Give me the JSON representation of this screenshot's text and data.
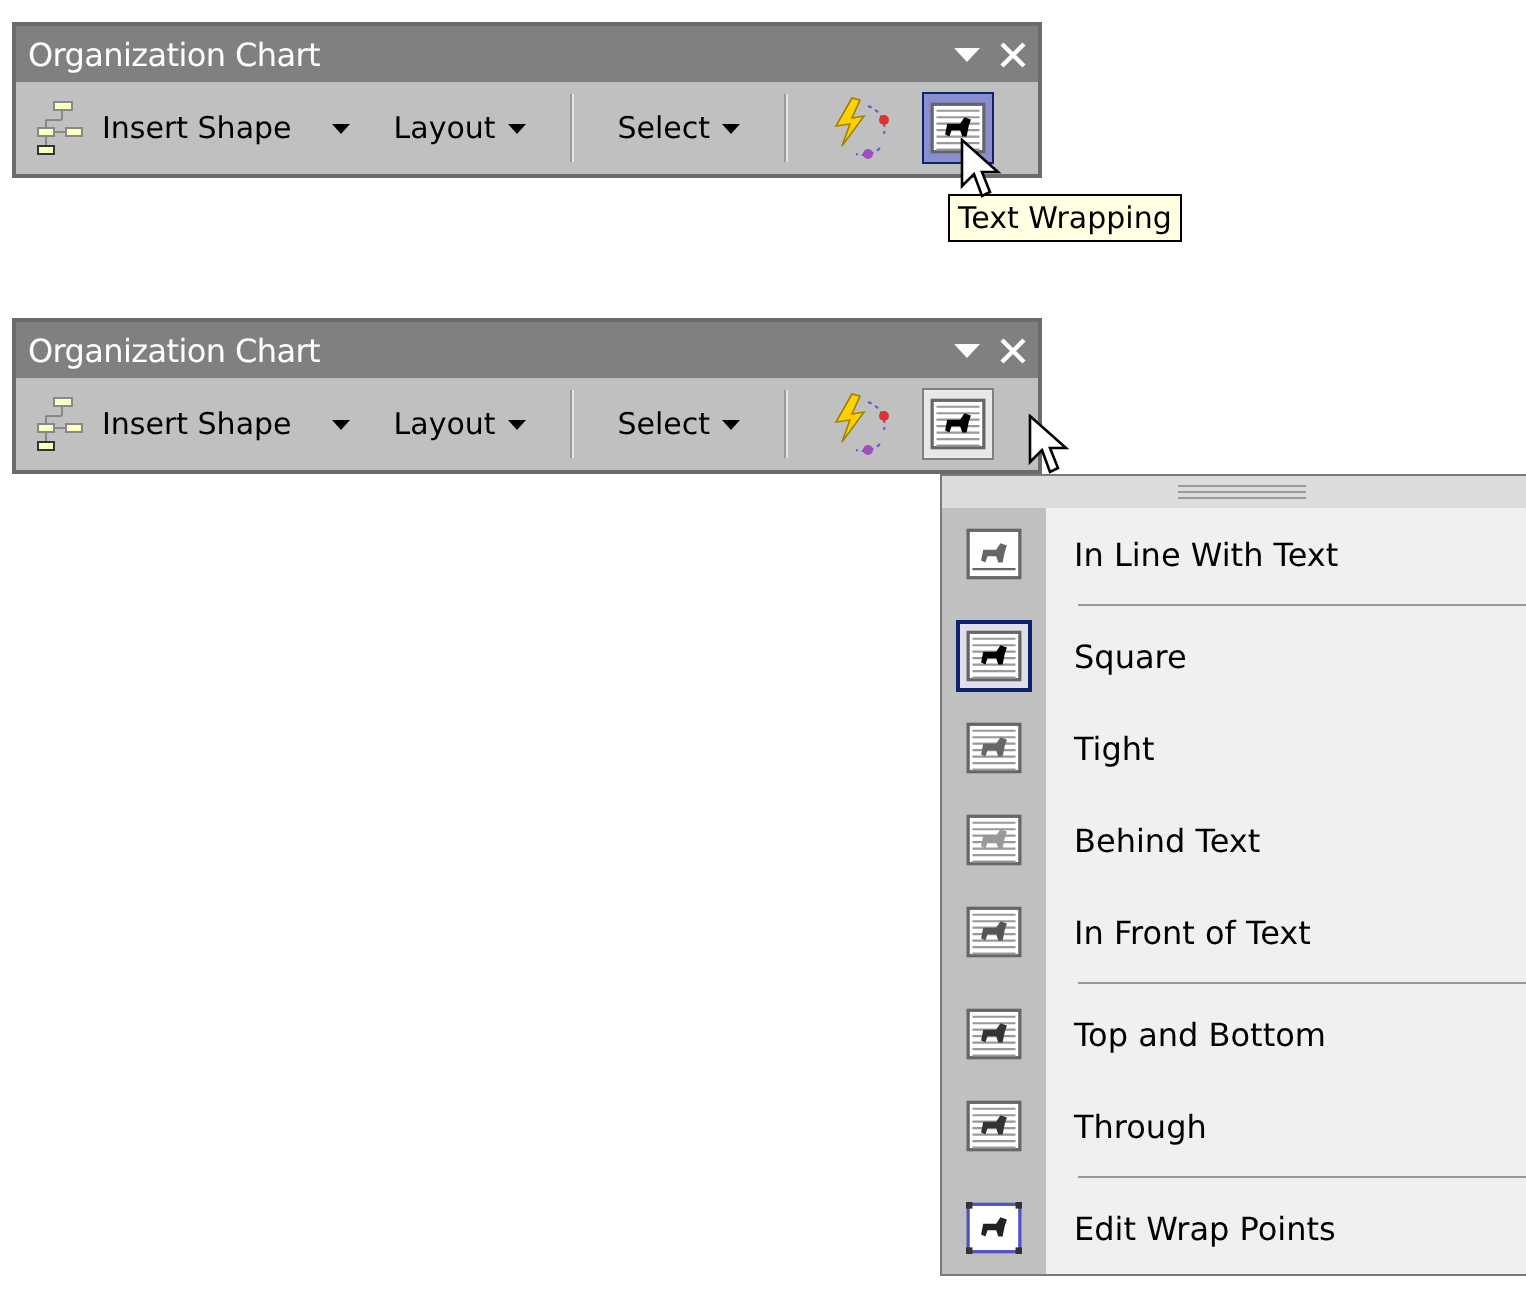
{
  "toolbars": [
    {
      "title": "Organization Chart",
      "buttons": [
        {
          "kind": "insert",
          "label": "Insert Shape"
        },
        {
          "kind": "dropdown",
          "label": "Layout"
        },
        {
          "kind": "dropdown",
          "label": "Select"
        },
        {
          "kind": "autoformat"
        },
        {
          "kind": "wrap",
          "hovered": true,
          "pressed": false
        }
      ],
      "tooltip": "Text Wrapping"
    },
    {
      "title": "Organization Chart",
      "buttons": [
        {
          "kind": "insert",
          "label": "Insert Shape"
        },
        {
          "kind": "dropdown",
          "label": "Layout"
        },
        {
          "kind": "dropdown",
          "label": "Select"
        },
        {
          "kind": "autoformat"
        },
        {
          "kind": "wrap",
          "hovered": false,
          "pressed": true
        }
      ],
      "menu": {
        "items": [
          {
            "kind": "inline",
            "label": "In Line With Text",
            "selected": false
          },
          {
            "kind": "separator"
          },
          {
            "kind": "square",
            "label": "Square",
            "selected": true
          },
          {
            "kind": "tight",
            "label": "Tight",
            "selected": false
          },
          {
            "kind": "behind",
            "label": "Behind Text",
            "selected": false
          },
          {
            "kind": "front",
            "label": "In Front of Text",
            "selected": false
          },
          {
            "kind": "separator"
          },
          {
            "kind": "topbottom",
            "label": "Top and Bottom",
            "selected": false
          },
          {
            "kind": "through",
            "label": "Through",
            "selected": false
          },
          {
            "kind": "separator"
          },
          {
            "kind": "edit",
            "label": "Edit Wrap Points",
            "selected": false
          }
        ]
      }
    }
  ]
}
